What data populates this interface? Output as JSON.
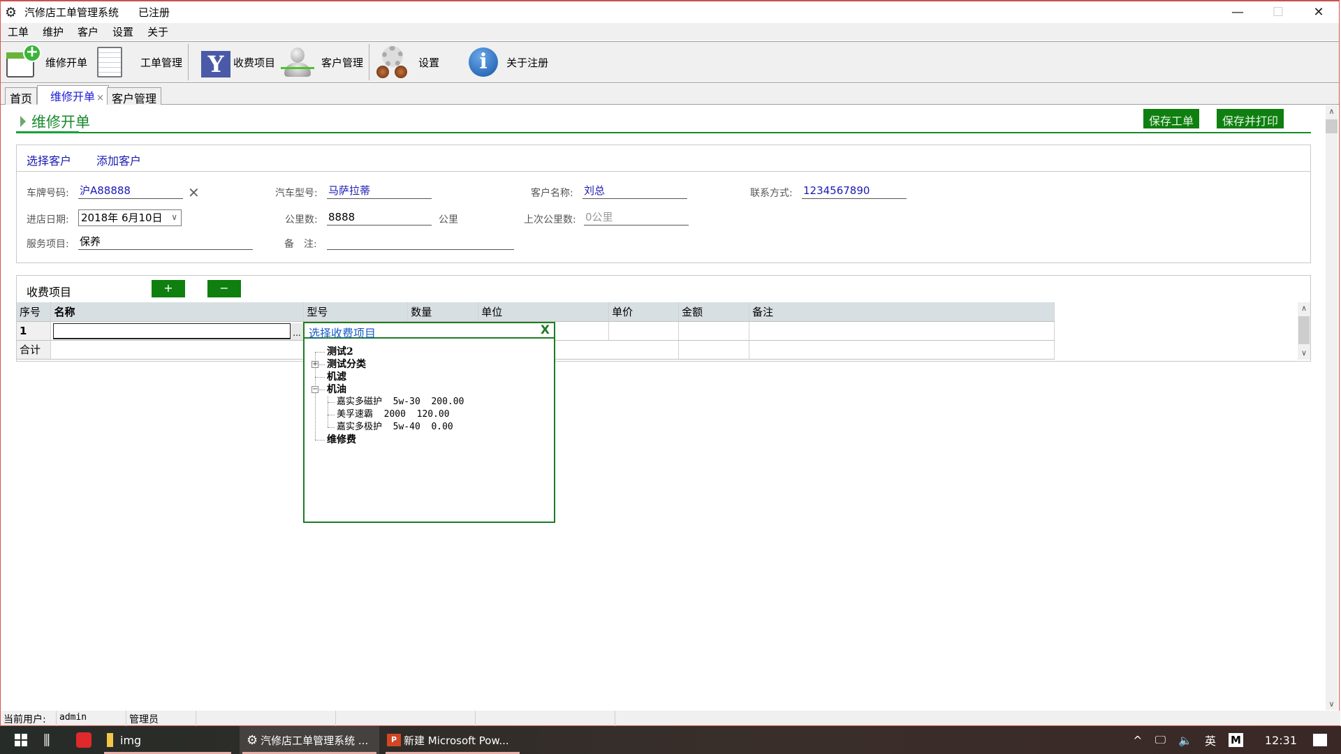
{
  "window": {
    "title": "汽修店工单管理系统",
    "registration_status": "已注册",
    "controls": {
      "minimize": "—",
      "maximize": "☐",
      "close": "✕"
    }
  },
  "menu": [
    "工单",
    "维护",
    "客户",
    "设置",
    "关于"
  ],
  "toolbar": [
    {
      "label": "维修开单",
      "icon": "new-order-icon"
    },
    {
      "label": "工单管理",
      "icon": "spreadsheet-icon"
    },
    {
      "label": "收费项目",
      "icon": "yahoo-y-icon"
    },
    {
      "label": "客户管理",
      "icon": "user-pulse-icon"
    },
    {
      "label": "设置",
      "icon": "gear-binoculars-icon"
    },
    {
      "label": "关于注册",
      "icon": "info-icon"
    }
  ],
  "tabs": [
    {
      "label": "首页",
      "active": false
    },
    {
      "label": "维修开单",
      "active": true,
      "closable": true,
      "close_glyph": "×"
    },
    {
      "label": "客户管理",
      "active": false
    }
  ],
  "page": {
    "title": "维修开单",
    "save_button": "保存工单",
    "save_print_button": "保存并打印"
  },
  "customer": {
    "select_link": "选择客户",
    "add_link": "添加客户",
    "fields": {
      "plate": {
        "label": "车牌号码:",
        "value": "沪A88888",
        "clear_glyph": "✕"
      },
      "car_model": {
        "label": "汽车型号:",
        "value": "马萨拉蒂"
      },
      "customer_name": {
        "label": "客户名称:",
        "value": "刘总"
      },
      "contact": {
        "label": "联系方式:",
        "value": "1234567890"
      },
      "date": {
        "label": "进店日期:",
        "value": "2018年  6月10日"
      },
      "mileage": {
        "label": "公里数:",
        "value": "8888",
        "unit": "公里"
      },
      "last_mileage": {
        "label": "上次公里数:",
        "placeholder": "0公里"
      },
      "service": {
        "label": "服务项目:",
        "value": "保养"
      },
      "remark": {
        "label": "备　注:",
        "value": ""
      }
    }
  },
  "fees": {
    "title": "收费项目",
    "add_button": "+",
    "remove_button": "−",
    "columns": [
      "序号",
      "名称",
      "型号",
      "数量",
      "单位",
      "单价",
      "金额",
      "备注"
    ],
    "rows": [
      {
        "index": "1",
        "name": "",
        "model": "",
        "qty": "",
        "unit": "",
        "price": "",
        "amount": "",
        "remark": ""
      }
    ],
    "total_label": "合计",
    "ellipsis": "..."
  },
  "picker": {
    "title": "选择收费项目",
    "close": "X",
    "tree": [
      {
        "label": "测试2",
        "expandable": false
      },
      {
        "label": "测试分类",
        "expandable": true,
        "expanded": false
      },
      {
        "label": "机滤",
        "expandable": false
      },
      {
        "label": "机油",
        "expandable": true,
        "expanded": true,
        "children": [
          "嘉实多磁护  5w-30  200.00",
          "美孚速霸  2000  120.00",
          "嘉实多极护  5w-40  0.00"
        ]
      },
      {
        "label": "维修费",
        "expandable": false
      }
    ]
  },
  "status": {
    "user_label": "当前用户:",
    "user": "admin",
    "role": "管理员"
  },
  "taskbar": {
    "items": [
      {
        "label": "",
        "icon": "youdao-icon"
      },
      {
        "label": "img",
        "icon": "folder-icon"
      },
      {
        "label": "汽修店工单管理系统 ...",
        "icon": "app-gear-icon",
        "active": true
      },
      {
        "label": "新建 Microsoft Pow...",
        "icon": "powerpoint-icon"
      }
    ],
    "tray": {
      "ime": "英",
      "m": "M",
      "time": "12:31"
    }
  }
}
